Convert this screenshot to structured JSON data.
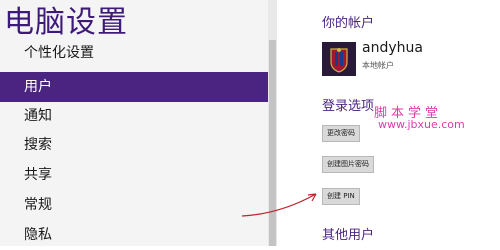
{
  "left": {
    "title": "电脑设置",
    "items": [
      {
        "label": "个性化设置",
        "active": false
      },
      {
        "label": "用户",
        "active": true
      },
      {
        "label": "通知",
        "active": false
      },
      {
        "label": "搜索",
        "active": false
      },
      {
        "label": "共享",
        "active": false
      },
      {
        "label": "常规",
        "active": false
      },
      {
        "label": "隐私",
        "active": false
      }
    ]
  },
  "right": {
    "your_account": "你的帐户",
    "username": "andyhua",
    "account_type": "本地帐户",
    "login_options": "登录选项",
    "change_password": "更改密码",
    "create_picture_password": "创建图片密码",
    "create_pin": "创建 PIN",
    "other_users": "其他用户"
  },
  "watermark": {
    "text": "脚本学堂",
    "url": "www.jbxue.com"
  },
  "colors": {
    "accent": "#4b2482",
    "title": "#3d1a78",
    "watermark": "#e03aa8",
    "arrow": "#c0202a"
  }
}
